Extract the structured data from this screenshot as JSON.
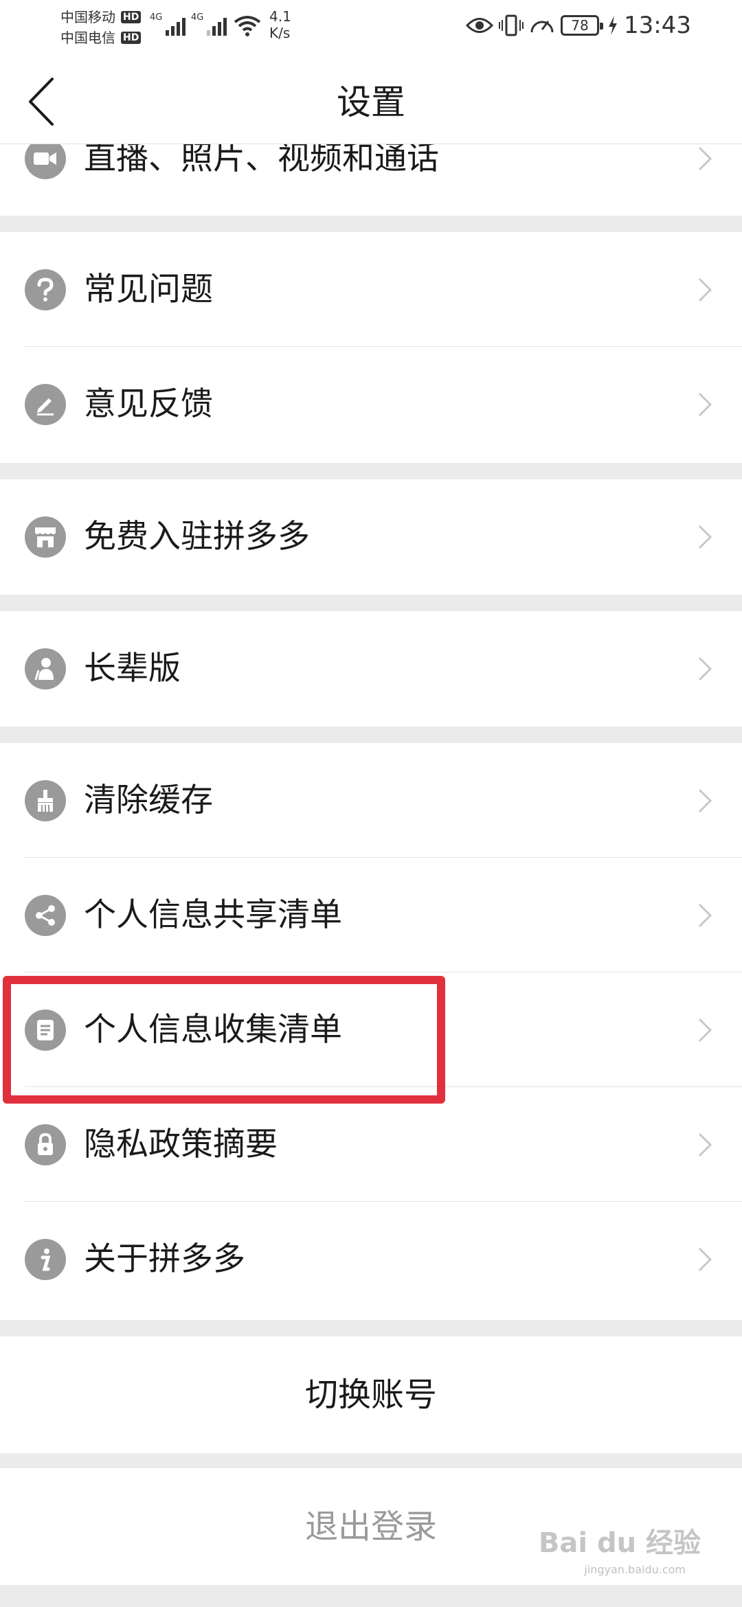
{
  "status_bar": {
    "carrier_1": "中国移动",
    "carrier_2": "中国电信",
    "hd_badge": "HD",
    "network_gen": "4G",
    "speed_value": "4.1",
    "speed_unit": "K/s",
    "battery": "78",
    "time": "13:43"
  },
  "header": {
    "back_icon": "chevron-left-icon",
    "title": "设置"
  },
  "sections": [
    {
      "items": [
        {
          "icon": "video-camera-icon",
          "label": "直播、照片、视频和通话"
        }
      ]
    },
    {
      "items": [
        {
          "icon": "question-icon",
          "label": "常见问题"
        },
        {
          "icon": "edit-icon",
          "label": "意见反馈"
        }
      ]
    },
    {
      "items": [
        {
          "icon": "storefront-icon",
          "label": "免费入驻拼多多"
        }
      ]
    },
    {
      "items": [
        {
          "icon": "elder-person-icon",
          "label": "长辈版"
        }
      ]
    },
    {
      "items": [
        {
          "icon": "broom-icon",
          "label": "清除缓存"
        },
        {
          "icon": "share-icon",
          "label": "个人信息共享清单"
        },
        {
          "icon": "document-icon",
          "label": "个人信息收集清单"
        },
        {
          "icon": "lock-icon",
          "label": "隐私政策摘要"
        },
        {
          "icon": "info-icon",
          "label": "关于拼多多"
        }
      ]
    }
  ],
  "actions": {
    "switch_account": "切换账号",
    "logout": "退出登录"
  },
  "annotation": {
    "highlight_color": "#e0303e"
  },
  "watermark": {
    "brand": "Bai du 经验",
    "url": "jingyan.baidu.com"
  }
}
